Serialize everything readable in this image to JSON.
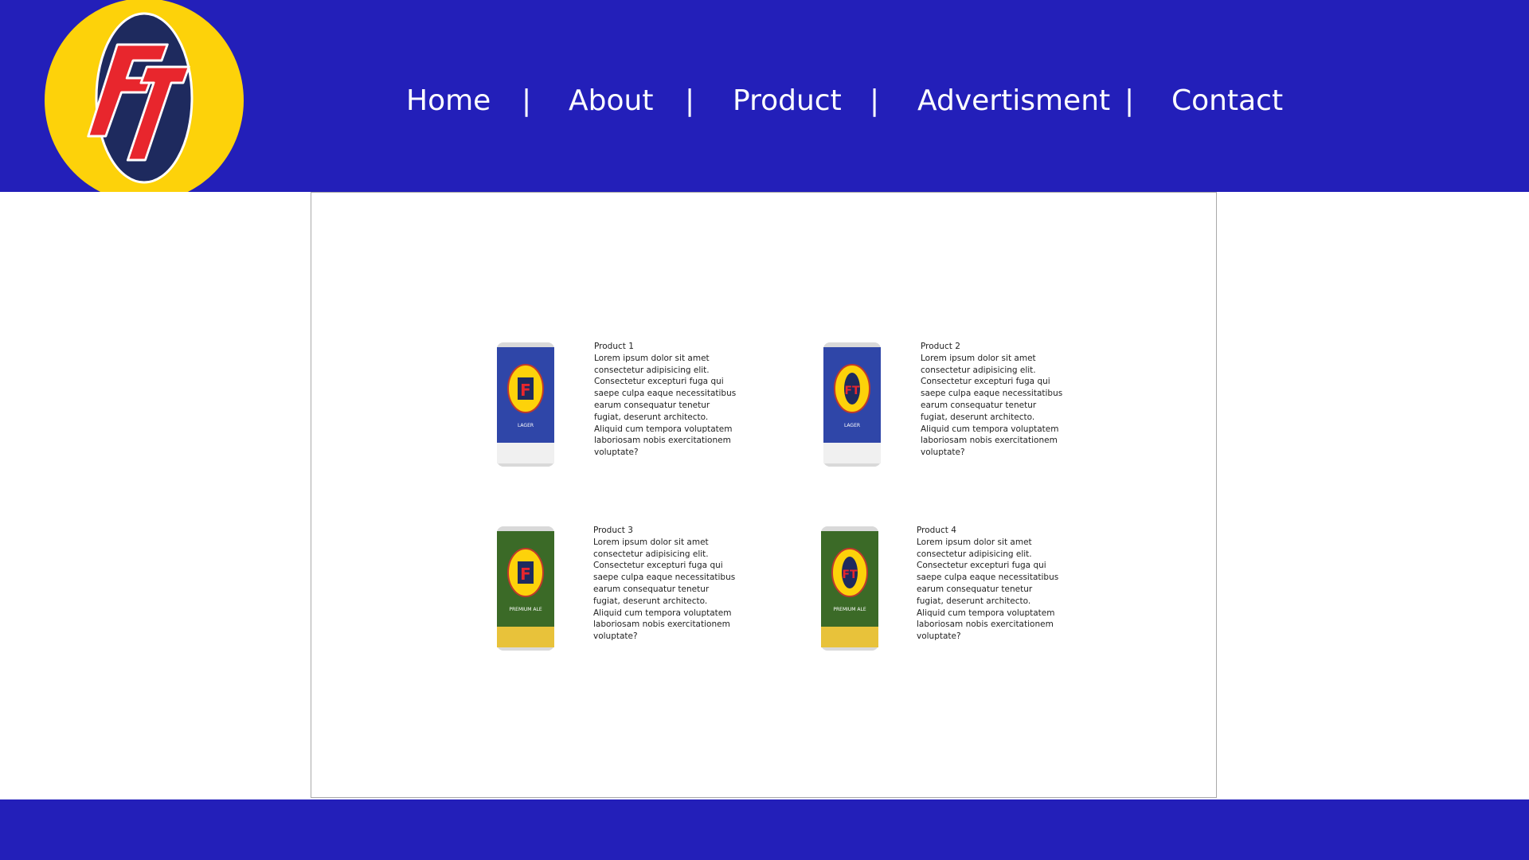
{
  "brand": {
    "logo_text": "FT",
    "colors": {
      "header_blue": "#231fb9",
      "logo_yellow": "#fdd20a",
      "logo_navy": "#1e2a5e",
      "logo_red": "#e8262d"
    }
  },
  "nav": {
    "items": [
      {
        "label": "Home"
      },
      {
        "label": "About"
      },
      {
        "label": "Product"
      },
      {
        "label": "Advertisment"
      },
      {
        "label": "Contact"
      }
    ],
    "separator": "|"
  },
  "products": [
    {
      "title": "Product 1",
      "description": "Lorem ipsum dolor sit amet consectetur adipisicing elit. Consectetur excepturi fuga qui saepe culpa eaque necessitatibus earum consequatur tenetur fugiat, deserunt architecto. Aliquid cum tempora voluptatem laboriosam nobis exercitationem voluptate?",
      "can": {
        "body_color": "#2f46a8",
        "emblem": "F",
        "label": "LAGER"
      }
    },
    {
      "title": "Product 2",
      "description": "Lorem ipsum dolor sit amet consectetur adipisicing elit. Consectetur excepturi fuga qui saepe culpa eaque necessitatibus earum consequatur tenetur fugiat, deserunt architecto. Aliquid cum tempora voluptatem laboriosam nobis exercitationem voluptate?",
      "can": {
        "body_color": "#2f46a8",
        "emblem": "FT",
        "label": "LAGER"
      }
    },
    {
      "title": "Product 3",
      "description": "Lorem ipsum dolor sit amet consectetur adipisicing elit. Consectetur excepturi fuga qui saepe culpa eaque necessitatibus earum consequatur tenetur fugiat, deserunt architecto. Aliquid cum tempora voluptatem laboriosam nobis exercitationem voluptate?",
      "can": {
        "body_color": "#3b6a27",
        "emblem": "F",
        "label": "PREMIUM ALE"
      }
    },
    {
      "title": "Product 4",
      "description": "Lorem ipsum dolor sit amet consectetur adipisicing elit. Consectetur excepturi fuga qui saepe culpa eaque necessitatibus earum consequatur tenetur fugiat, deserunt architecto. Aliquid cum tempora voluptatem laboriosam nobis exercitationem voluptate?",
      "can": {
        "body_color": "#3b6a27",
        "emblem": "FT",
        "label": "PREMIUM ALE"
      }
    }
  ]
}
